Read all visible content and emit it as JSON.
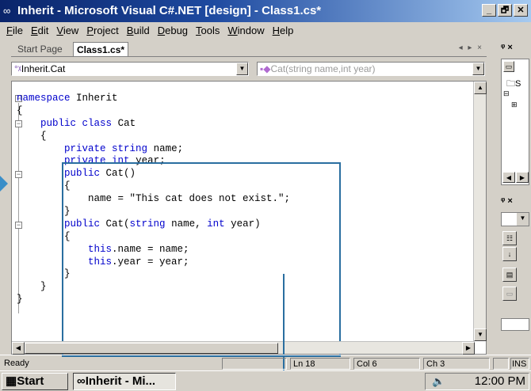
{
  "window": {
    "title": "Inherit - Microsoft Visual C#.NET [design] - Class1.cs*",
    "controls": [
      "_",
      "🗗",
      "✕"
    ]
  },
  "menu": [
    "File",
    "Edit",
    "View",
    "Project",
    "Build",
    "Debug",
    "Tools",
    "Window",
    "Help"
  ],
  "menu_mnemonics": [
    "F",
    "E",
    "V",
    "P",
    "B",
    "D",
    "T",
    "W",
    "H"
  ],
  "tabs": {
    "start_page": "Start Page",
    "active": "Class1.cs*",
    "nav": "◂ ▸ ×"
  },
  "dropdowns": {
    "type": "Inherit.Cat",
    "member": "Cat(string name,int year)"
  },
  "code_lines": [
    "namespace Inherit",
    "{",
    "    public class Cat",
    "    {",
    "        private string name;",
    "        private int year;",
    "        public Cat()",
    "        {",
    "            name = \"This cat does not exist.\";",
    "        }",
    "        public Cat(string name, int year)",
    "        {",
    "            this.name = name;",
    "            this.year = year;",
    "        }",
    "    }",
    "}"
  ],
  "right_panel": {
    "pin1": "ᵠ ×",
    "pin2": "ᵠ ×",
    "item_s": "S"
  },
  "status": {
    "ready": "Ready",
    "line": "Ln 18",
    "col": "Col 6",
    "ch": "Ch 3",
    "mode": "INS"
  },
  "taskbar": {
    "start": "Start",
    "task": "Inherit - Mi...",
    "clock": "12:00 PM"
  },
  "colors": {
    "titlebar": "#0a246a",
    "keyword": "#0000cc",
    "highlight": "#2a6ea0"
  }
}
